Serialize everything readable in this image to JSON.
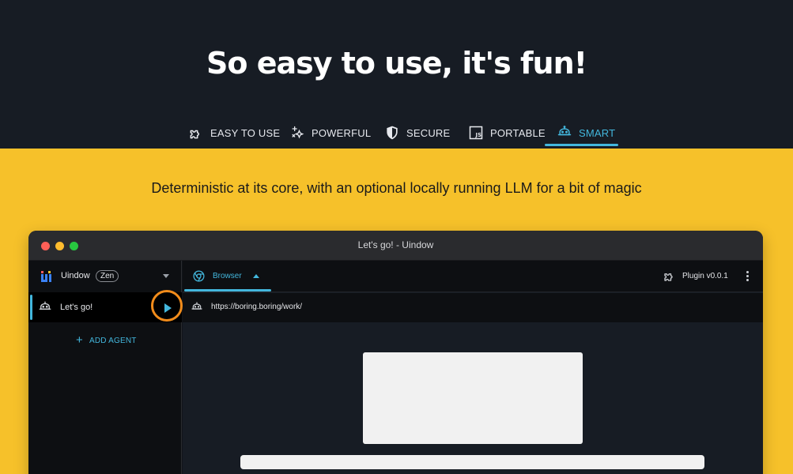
{
  "headline": "So easy to use, it's fun!",
  "tabs": [
    {
      "label": "EASY TO USE",
      "icon": "puzzle-icon"
    },
    {
      "label": "POWERFUL",
      "icon": "sparkle-icon"
    },
    {
      "label": "SECURE",
      "icon": "shield-icon"
    },
    {
      "label": "PORTABLE",
      "icon": "js-icon"
    },
    {
      "label": "SMART",
      "icon": "robot-icon",
      "active": true
    }
  ],
  "subtitle": "Deterministic at its core, with an optional locally running LLM for a bit of magic",
  "window": {
    "title": "Let's go! - Uindow"
  },
  "sidebar": {
    "workspace_name": "Uindow",
    "workspace_badge": "Zen",
    "agents": [
      {
        "name": "Let's go!"
      }
    ],
    "add_agent_label": "ADD AGENT"
  },
  "pane": {
    "tab_label": "Browser",
    "plugin_label": "Plugin v0.0.1",
    "url": "https://boring.boring/work/"
  },
  "colors": {
    "header_bg": "#171c24",
    "band_bg": "#f6c12a",
    "accent": "#43b7dd",
    "highlight": "#f28c1b"
  }
}
